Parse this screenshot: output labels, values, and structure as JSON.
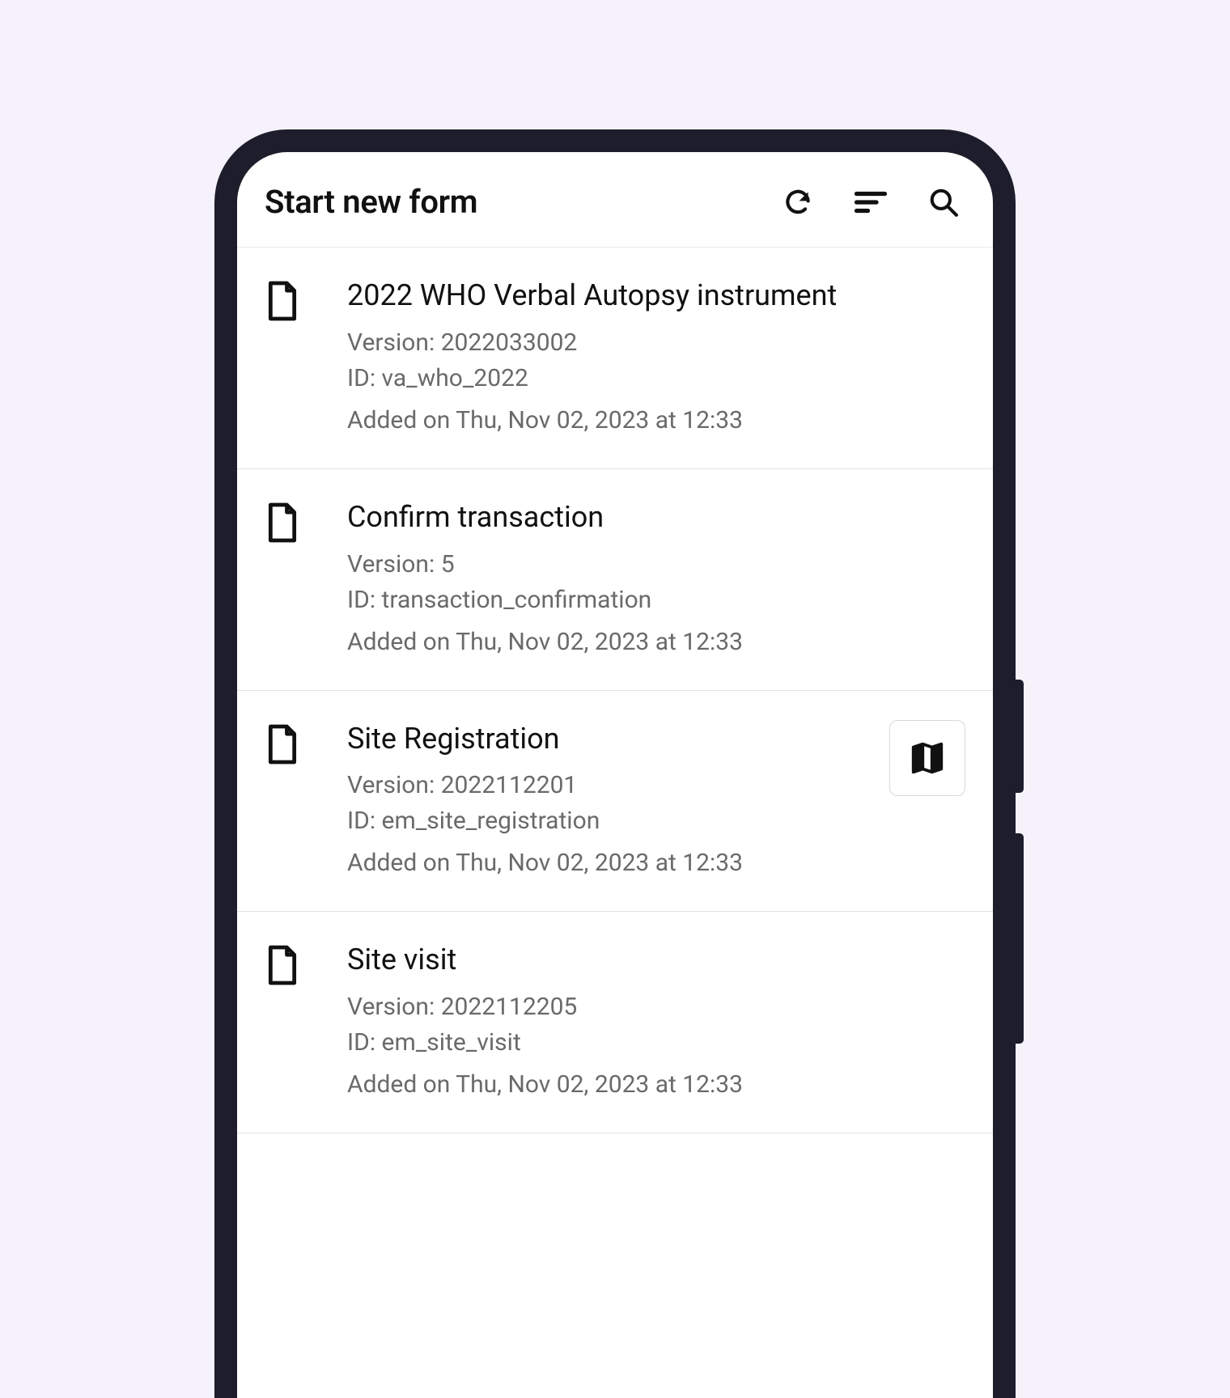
{
  "header": {
    "title": "Start new form"
  },
  "labels": {
    "version_prefix": "Version: ",
    "id_prefix": "ID: ",
    "added_prefix": "Added on "
  },
  "forms": [
    {
      "title": "2022 WHO Verbal Autopsy instrument",
      "version": "2022033002",
      "id": "va_who_2022",
      "added": "Thu, Nov 02, 2023 at 12:33",
      "has_map": false
    },
    {
      "title": "Confirm transaction",
      "version": "5",
      "id": "transaction_confirmation",
      "added": "Thu, Nov 02, 2023 at 12:33",
      "has_map": false
    },
    {
      "title": "Site Registration",
      "version": "2022112201",
      "id": "em_site_registration",
      "added": "Thu, Nov 02, 2023 at 12:33",
      "has_map": true
    },
    {
      "title": "Site visit",
      "version": "2022112205",
      "id": "em_site_visit",
      "added": "Thu, Nov 02, 2023 at 12:33",
      "has_map": false
    }
  ]
}
